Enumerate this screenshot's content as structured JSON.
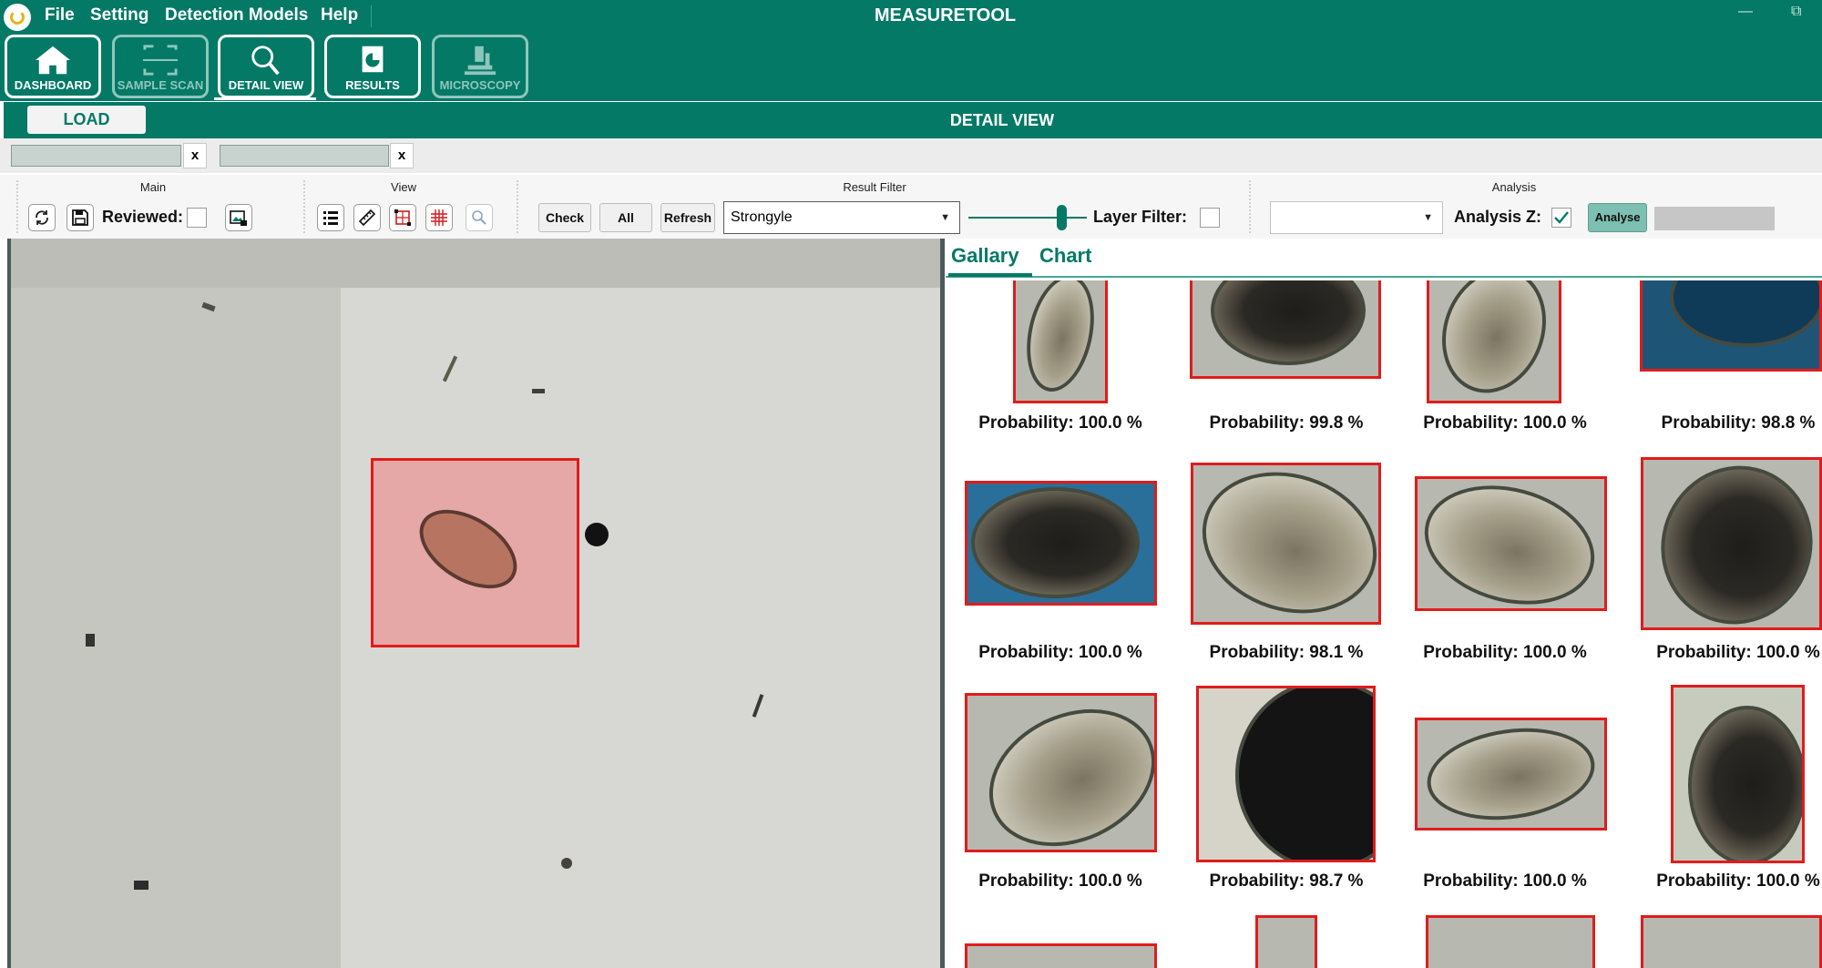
{
  "app": {
    "title": "MEASURETOOL",
    "logo_icon": "app-logo-icon"
  },
  "menu": {
    "items": [
      "File",
      "Setting",
      "Detection Models",
      "Help"
    ]
  },
  "window_controls": {
    "minimize": "—",
    "restore": "⧉"
  },
  "nav": {
    "dashboard": "DASHBOARD",
    "sample_scan": "SAMPLE SCAN",
    "detail_view": "DETAIL VIEW",
    "results": "RESULTS",
    "microscopy": "MICROSCOPY",
    "active": "DETAIL VIEW"
  },
  "detail": {
    "load_label": "LOAD",
    "title": "DETAIL VIEW"
  },
  "files": {
    "field1": "",
    "field2": "",
    "clear_label": "x"
  },
  "ribbon": {
    "main_title": "Main",
    "reviewed_label": "Reviewed:",
    "reviewed_checked": false,
    "view_title": "View",
    "result_filter_title": "Result Filter",
    "check_label": "Check",
    "all_label": "All",
    "refresh_label": "Refresh",
    "filter_value": "Strongyle",
    "layer_filter_label": "Layer Filter:",
    "layer_filter_checked": false,
    "analysis_title": "Analysis",
    "analysis_value": "",
    "analysis_z_label": "Analysis Z:",
    "analysis_z_checked": true,
    "analyse_label": "Analyse"
  },
  "tabs": {
    "gallery": "Gallary",
    "chart": "Chart",
    "active": "Gallary"
  },
  "gallery": [
    {
      "probability": "Probability: 100.0 %"
    },
    {
      "probability": "Probability: 99.8 %"
    },
    {
      "probability": "Probability: 100.0 %"
    },
    {
      "probability": "Probability: 98.8 %"
    },
    {
      "probability": "Probability: 100.0 %"
    },
    {
      "probability": "Probability: 98.1 %"
    },
    {
      "probability": "Probability: 100.0 %"
    },
    {
      "probability": "Probability: 100.0 %"
    },
    {
      "probability": "Probability: 100.0 %"
    },
    {
      "probability": "Probability: 98.7 %"
    },
    {
      "probability": "Probability: 100.0 %"
    },
    {
      "probability": "Probability: 100.0 %"
    }
  ],
  "colors": {
    "brand": "#037966",
    "detection": "#e11b1b"
  }
}
